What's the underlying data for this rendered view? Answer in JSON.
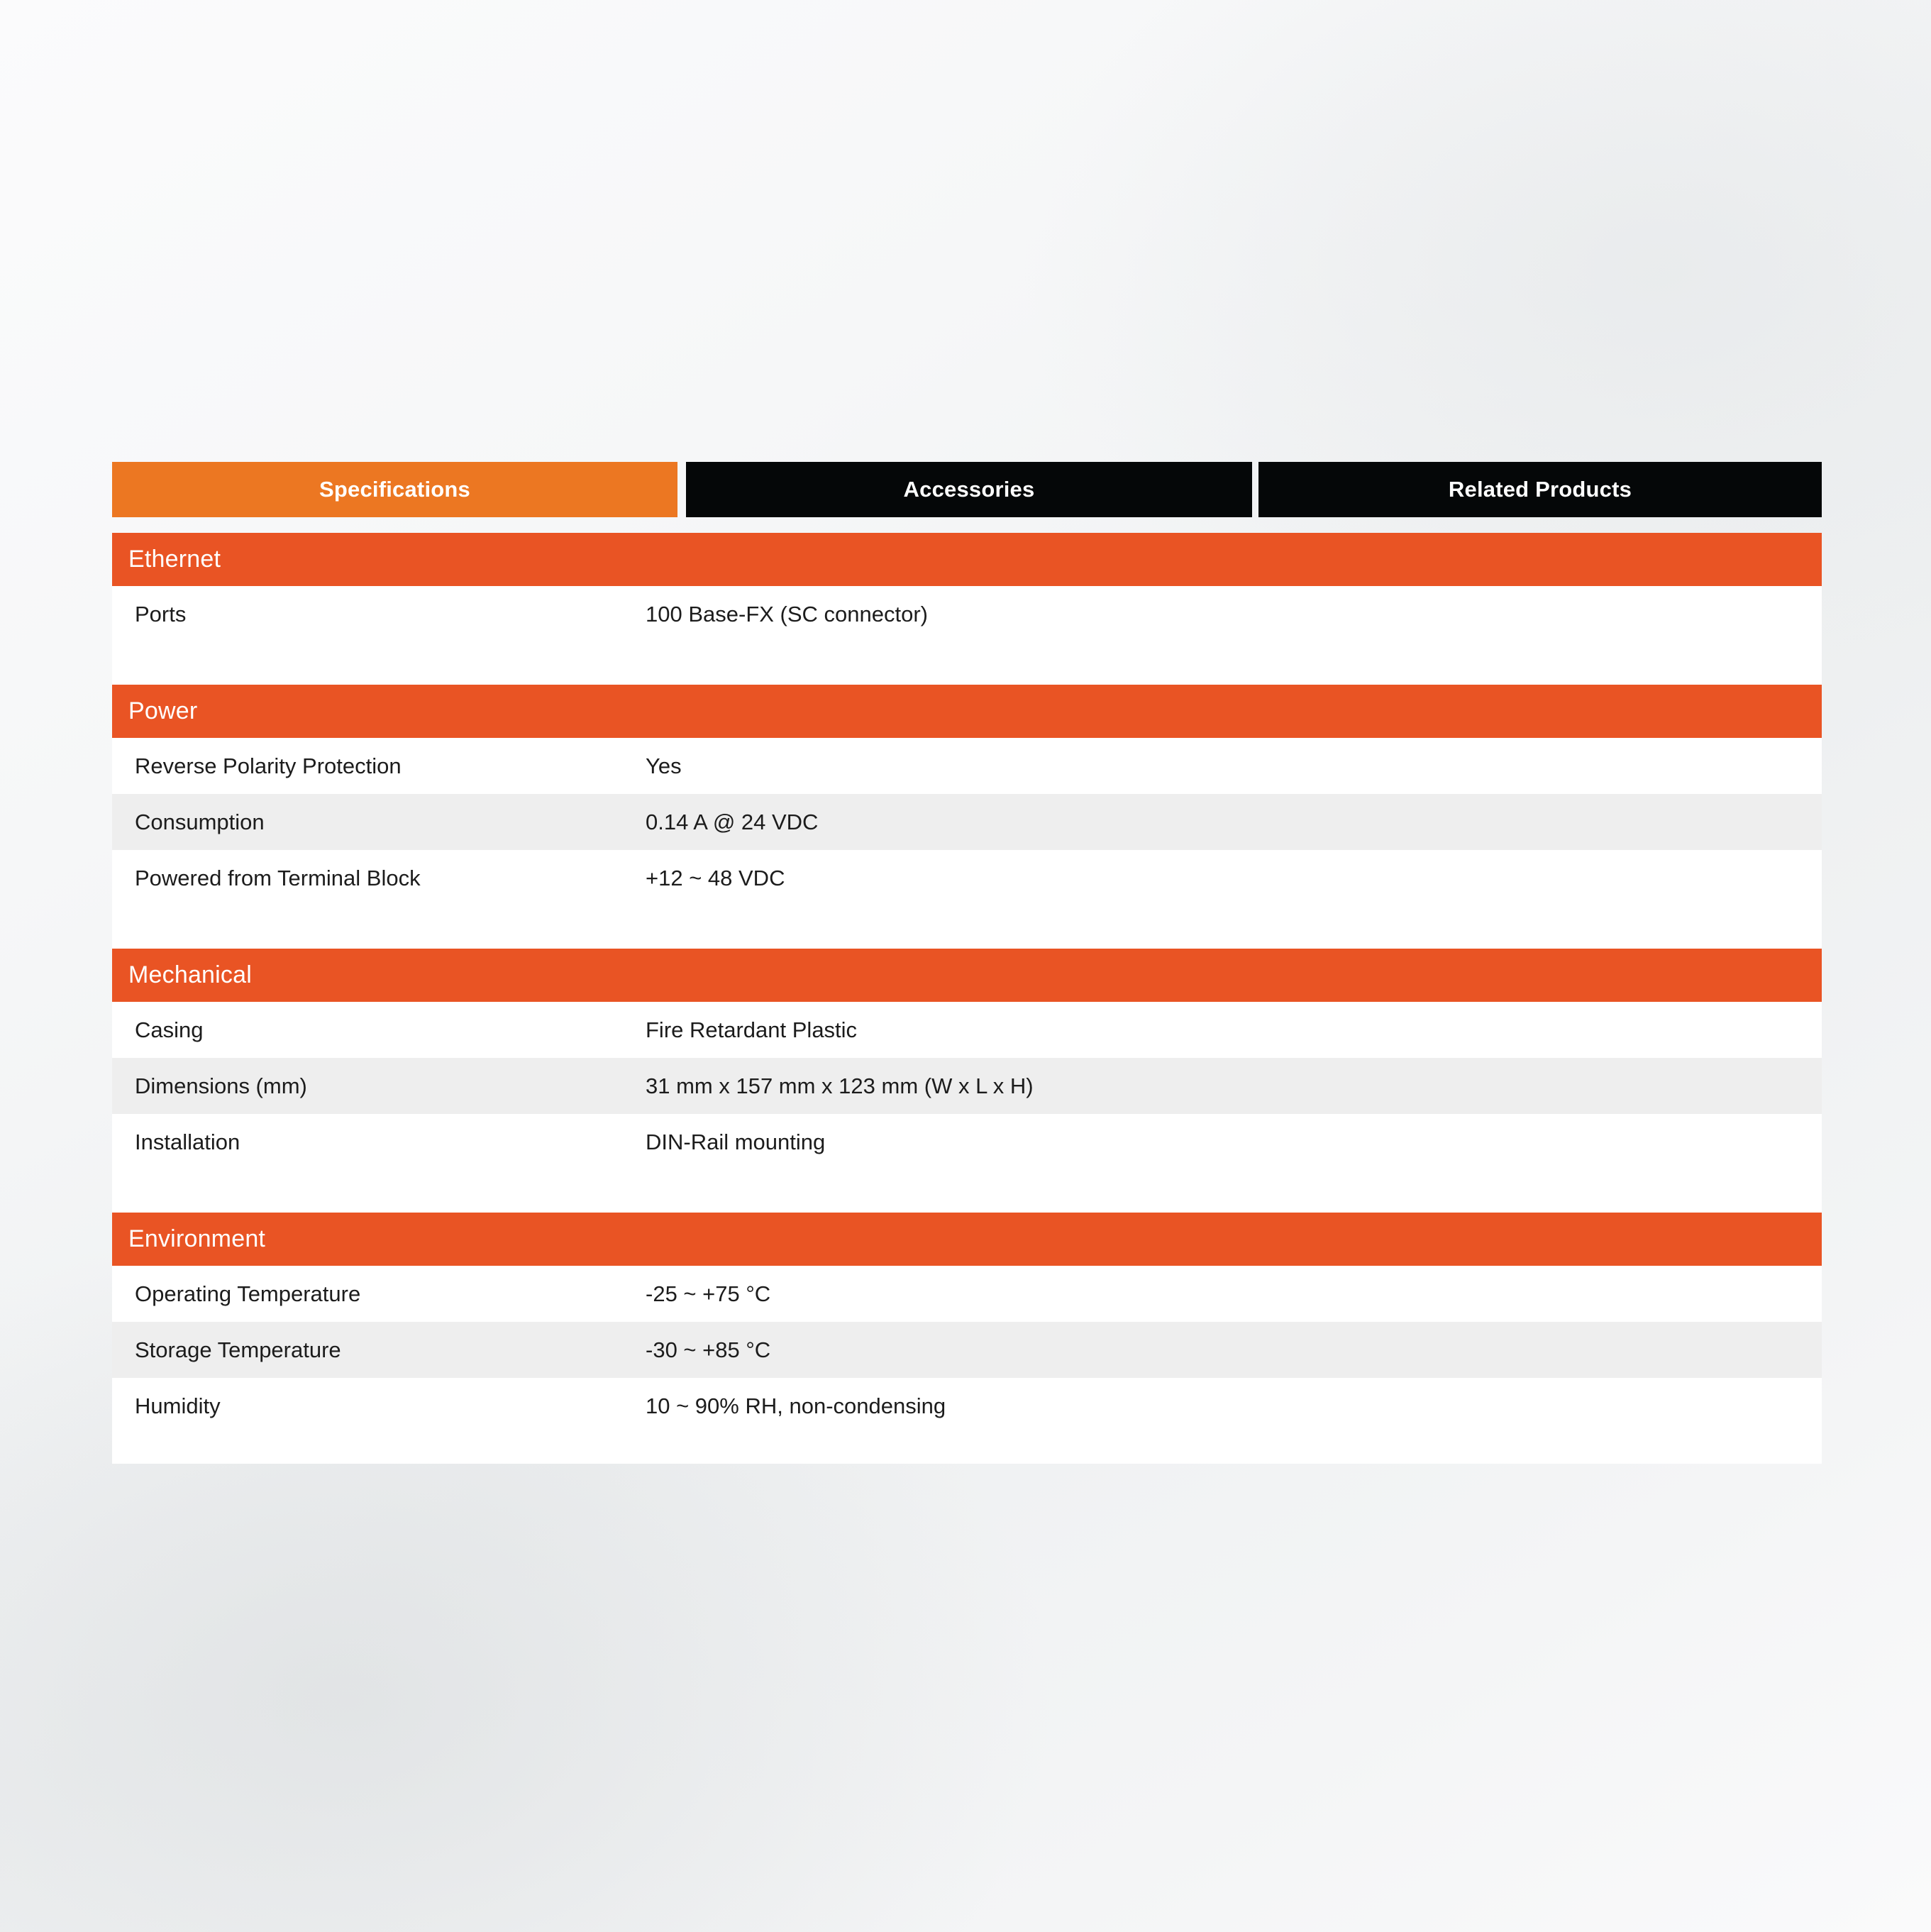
{
  "tabs": [
    {
      "label": "Specifications",
      "state": "active"
    },
    {
      "label": "Accessories",
      "state": "inactive"
    },
    {
      "label": "Related Products",
      "state": "inactive"
    }
  ],
  "colors": {
    "tab_active": "#EC7722",
    "tab_inactive": "#050708",
    "section_header": "#E95424",
    "row_alt": "#EEEEEE",
    "row_base": "#FFFFFF",
    "text": "#1C1C1C",
    "page_background": "#F2F3F4"
  },
  "spec_sections": [
    {
      "title": "Ethernet",
      "rows": [
        {
          "label": "Ports",
          "value": "100 Base-FX (SC connector)"
        }
      ]
    },
    {
      "title": "Power",
      "rows": [
        {
          "label": "Reverse Polarity Protection",
          "value": "Yes"
        },
        {
          "label": "Consumption",
          "value": "0.14 A @ 24 VDC"
        },
        {
          "label": "Powered from Terminal Block",
          "value": "+12 ~ 48 VDC"
        }
      ]
    },
    {
      "title": "Mechanical",
      "rows": [
        {
          "label": "Casing",
          "value": "Fire Retardant Plastic"
        },
        {
          "label": "Dimensions (mm)",
          "value": "31 mm x 157 mm x 123 mm (W x L x H)"
        },
        {
          "label": "Installation",
          "value": "DIN-Rail mounting"
        }
      ]
    },
    {
      "title": "Environment",
      "rows": [
        {
          "label": "Operating Temperature",
          "value": "-25 ~ +75 °C"
        },
        {
          "label": "Storage Temperature",
          "value": "-30 ~ +85 °C"
        },
        {
          "label": "Humidity",
          "value": "10 ~ 90% RH, non-condensing"
        }
      ]
    }
  ]
}
